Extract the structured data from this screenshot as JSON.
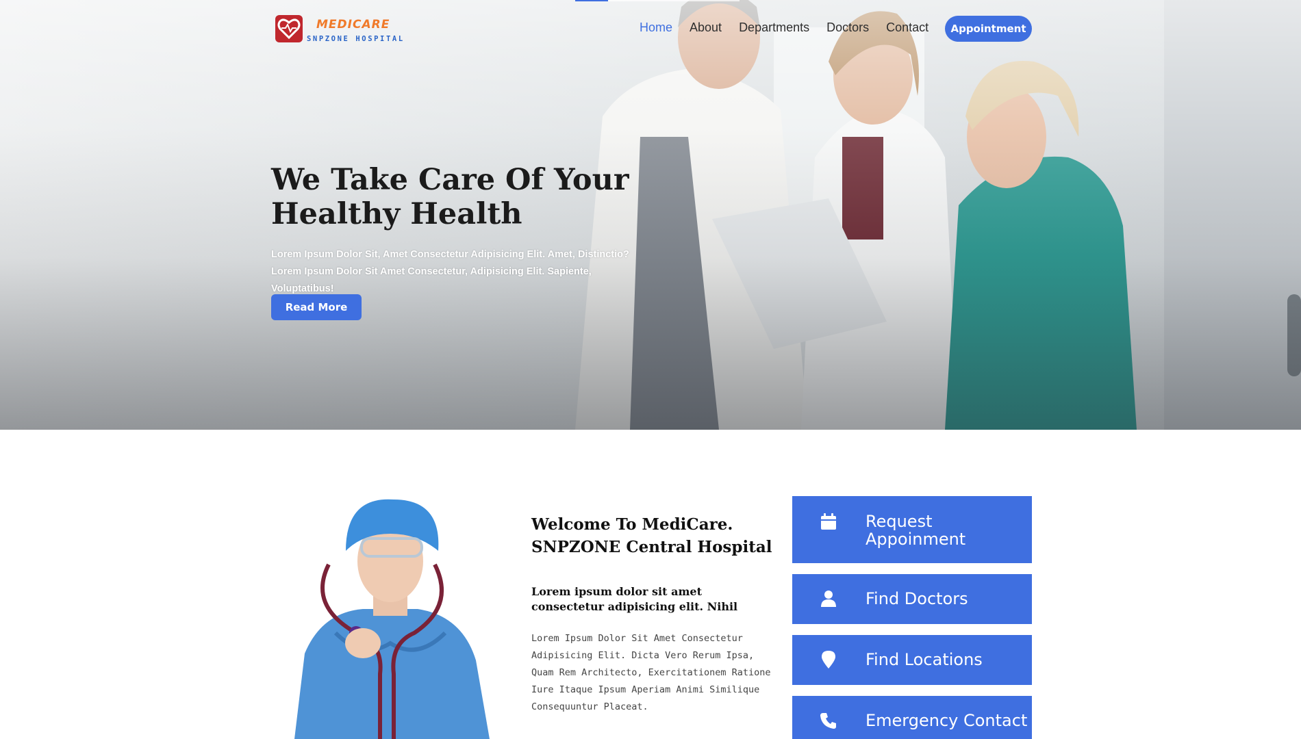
{
  "brand": {
    "name": "MEDICARE",
    "tagline": "SNPZONE HOSPITAL",
    "colors": {
      "accent": "#3f6fe0",
      "logo_orange": "#f07a2a",
      "logo_red": "#c0272d"
    },
    "icon": "heart-logo-icon"
  },
  "nav": {
    "items": [
      {
        "label": "Home",
        "active": true
      },
      {
        "label": "About",
        "active": false
      },
      {
        "label": "Departments",
        "active": false
      },
      {
        "label": "Doctors",
        "active": false
      },
      {
        "label": "Contact",
        "active": false
      }
    ],
    "cta_label": "Appointment"
  },
  "hero": {
    "title": "We Take Care Of Your Healthy Health",
    "text": "Lorem Ipsum Dolor Sit, Amet Consectetur Adipisicing Elit. Amet, Distinctio? Lorem Ipsum Dolor Sit Amet Consectetur, Adipisicing Elit. Sapiente, Voluptatibus!",
    "button_label": "Read More"
  },
  "welcome": {
    "title": "Welcome To MediCare. SNPZONE Central Hospital",
    "subtitle": "Lorem ipsum dolor sit amet consectetur adipisicing elit. Nihil",
    "text": "Lorem Ipsum Dolor Sit Amet Consectetur Adipisicing Elit. Dicta Vero Rerum Ipsa, Quam Rem Architecto, Exercitationem Ratione Iure Itaque Ipsum Aperiam Animi Similique Consequuntur Placeat."
  },
  "services": [
    {
      "label": "Request Appoinment",
      "icon": "calendar-icon"
    },
    {
      "label": "Find Doctors",
      "icon": "user-icon"
    },
    {
      "label": "Find Locations",
      "icon": "map-pin-icon"
    },
    {
      "label": "Emergency Contact",
      "icon": "phone-icon"
    }
  ]
}
